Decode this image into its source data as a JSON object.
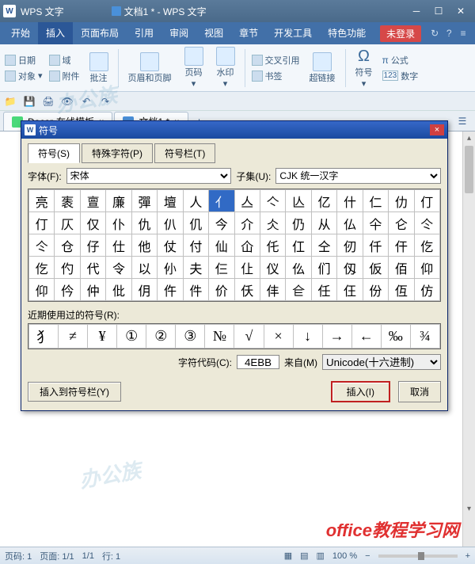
{
  "titlebar": {
    "app": "WPS 文字",
    "doc": "文档1 * - WPS 文字"
  },
  "tabs": [
    "开始",
    "插入",
    "页面布局",
    "引用",
    "审阅",
    "视图",
    "章节",
    "开发工具",
    "特色功能"
  ],
  "activeTab": "插入",
  "notlogin": "未登录",
  "ribbon": {
    "date": "日期",
    "field": "域",
    "object": "对象",
    "attachment": "附件",
    "comment": "批注",
    "headerfooter": "页眉和页脚",
    "pagenum": "页码",
    "watermark": "水印",
    "hyperlink": "超链接",
    "crossref": "交叉引用",
    "bookmark": "书签",
    "symbol": "符号",
    "formula": "公式",
    "number": "数字"
  },
  "doctabs": {
    "docer": "Docer-在线模板",
    "doc1": "文档1 *"
  },
  "dialog": {
    "title": "符号",
    "tabs": {
      "symbols": "符号(S)",
      "special": "特殊字符(P)",
      "bar": "符号栏(T)"
    },
    "fontLabel": "字体(F):",
    "fontValue": "宋体",
    "subsetLabel": "子集(U):",
    "subsetValue": "CJK 统一汉字",
    "grid": [
      [
        "亮",
        "袠",
        "亶",
        "廉",
        "彈",
        "壇",
        "人",
        "亻",
        "亼",
        "亽",
        "亾",
        "亿",
        "什",
        "仁",
        "仂",
        "仃"
      ],
      [
        "仃",
        "仄",
        "仅",
        "仆",
        "仇",
        "仈",
        "仉",
        "今",
        "介",
        "仌",
        "仍",
        "从",
        "仏",
        "仐",
        "仑",
        "仒"
      ],
      [
        "仒",
        "仓",
        "仔",
        "仕",
        "他",
        "仗",
        "付",
        "仙",
        "仚",
        "仛",
        "仜",
        "仝",
        "仞",
        "仟",
        "仠",
        "仡"
      ],
      [
        "仡",
        "仢",
        "代",
        "令",
        "以",
        "仦",
        "夫",
        "仨",
        "仩",
        "仪",
        "仫",
        "们",
        "仭",
        "仮",
        "佰",
        "仰"
      ],
      [
        "仰",
        "仱",
        "仲",
        "仳",
        "仴",
        "仵",
        "件",
        "价",
        "仸",
        "仹",
        "仺",
        "任",
        "仼",
        "份",
        "仾",
        "仿"
      ]
    ],
    "selectedRow": 0,
    "selectedCol": 7,
    "recentLabel": "近期使用过的符号(R):",
    "recent": [
      "犭",
      "≠",
      "¥",
      "①",
      "②",
      "③",
      "№",
      "√",
      "×",
      "↓",
      "→",
      "←",
      "‰",
      "¾"
    ],
    "codeLabel": "字符代码(C):",
    "codeValue": "4EBB",
    "fromLabel": "来自(M)",
    "fromValue": "Unicode(十六进制)",
    "insertBarBtn": "插入到符号栏(Y)",
    "insertBtn": "插入(I)",
    "cancelBtn": "取消"
  },
  "status": {
    "page": "页码: 1",
    "pageof": "页面: 1/1",
    "section": "1/1",
    "line": "行: 1",
    "zoom": "100 %"
  },
  "brand": "office教程学习网"
}
